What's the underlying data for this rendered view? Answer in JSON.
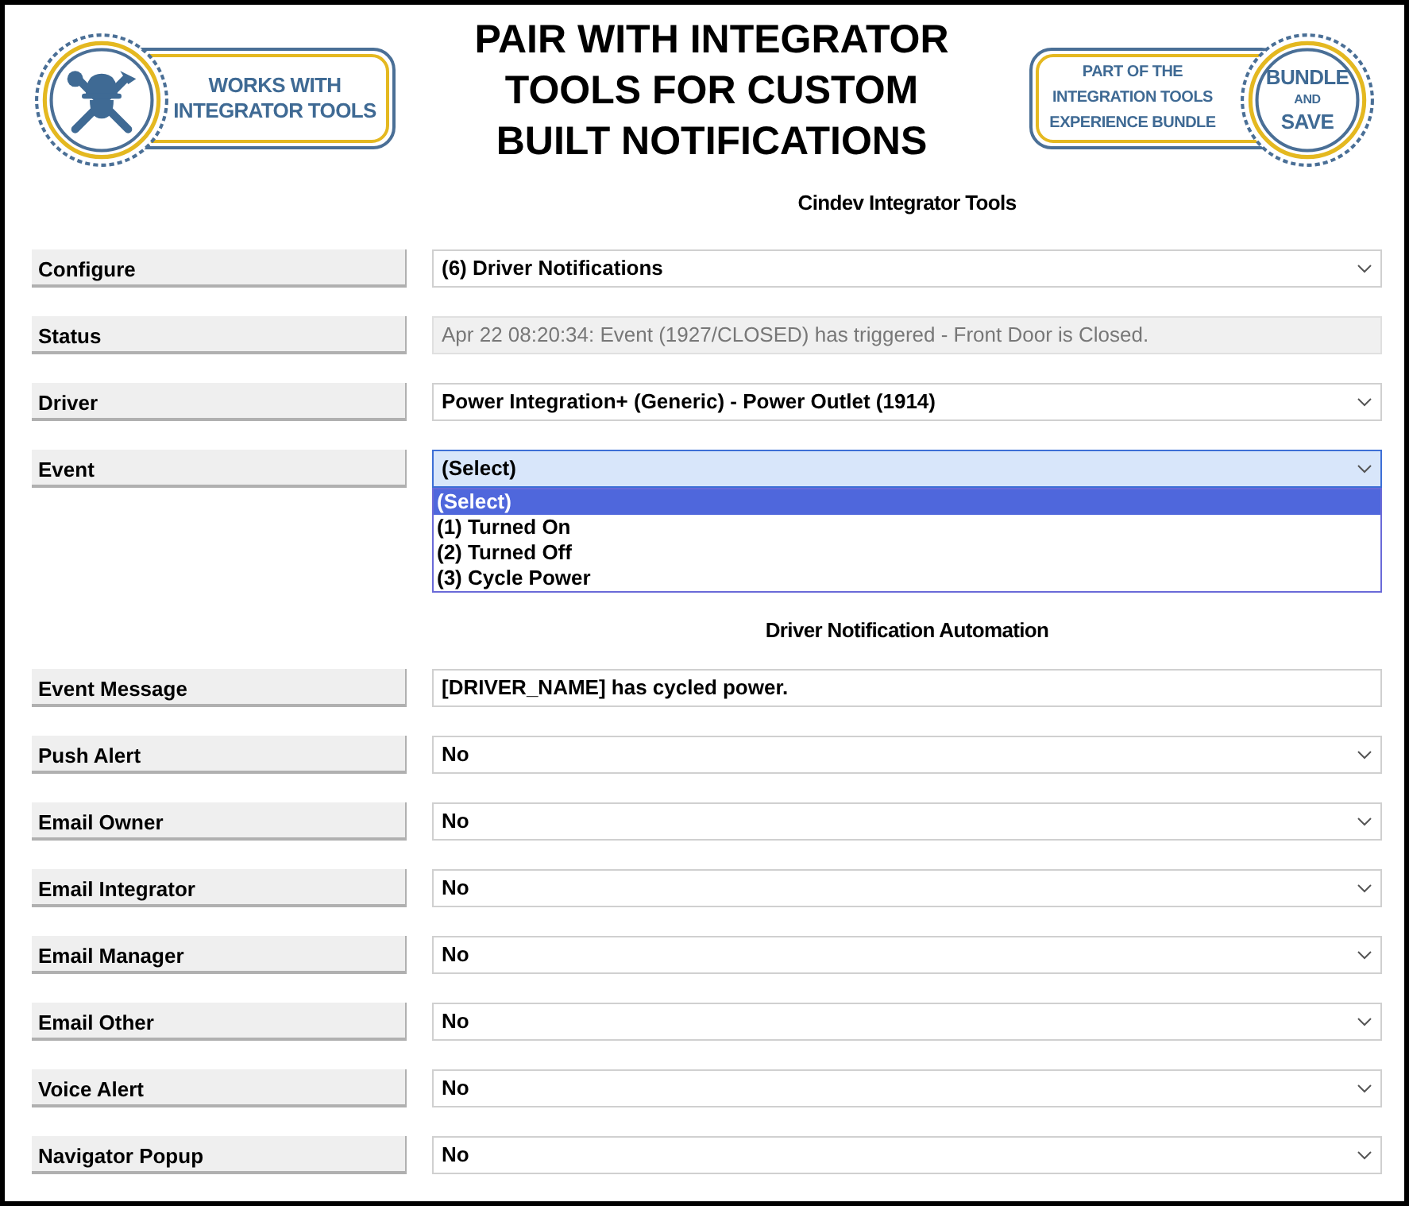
{
  "badges": [
    {
      "kind": "works_with",
      "lines": [
        "WORKS WITH",
        "INTEGRATOR TOOLS"
      ]
    },
    {
      "kind": "bundle",
      "lines": [
        "PART OF THE",
        "INTEGRATION TOOLS",
        "EXPERIENCE BUNDLE"
      ],
      "seal": [
        "BUNDLE",
        "AND",
        "SAVE"
      ]
    }
  ],
  "title": [
    "PAIR WITH INTEGRATOR",
    "TOOLS FOR CUSTOM",
    "BUILT NOTIFICATIONS"
  ],
  "sections": [
    {
      "heading": "Cindev Integrator Tools",
      "rows": [
        {
          "label": "Configure",
          "kind": "select",
          "value": "(6) Driver Notifications"
        },
        {
          "label": "Status",
          "kind": "readonly",
          "value": "Apr 22 08:20:34: Event (1927/CLOSED) has triggered - Front Door is Closed."
        },
        {
          "label": "Driver",
          "kind": "select",
          "value": "Power Integration+ (Generic) - Power Outlet (1914)"
        },
        {
          "label": "Event",
          "kind": "select",
          "value": "(Select)",
          "expanded": true,
          "options": [
            {
              "label": "(Select)",
              "selected": true
            },
            {
              "label": "(1) Turned On",
              "selected": false
            },
            {
              "label": "(2) Turned Off",
              "selected": false
            },
            {
              "label": "(3) Cycle Power",
              "selected": false
            }
          ]
        }
      ]
    },
    {
      "heading": "Driver Notification Automation",
      "rows": [
        {
          "label": "Event Message",
          "kind": "text",
          "value": "[DRIVER_NAME] has cycled power."
        },
        {
          "label": "Push Alert",
          "kind": "select",
          "value": "No"
        },
        {
          "label": "Email Owner",
          "kind": "select",
          "value": "No"
        },
        {
          "label": "Email Integrator",
          "kind": "select",
          "value": "No"
        },
        {
          "label": "Email Manager",
          "kind": "select",
          "value": "No"
        },
        {
          "label": "Email Other",
          "kind": "select",
          "value": "No"
        },
        {
          "label": "Voice Alert",
          "kind": "select",
          "value": "No"
        },
        {
          "label": "Navigator Popup",
          "kind": "select",
          "value": "No"
        }
      ]
    }
  ]
}
